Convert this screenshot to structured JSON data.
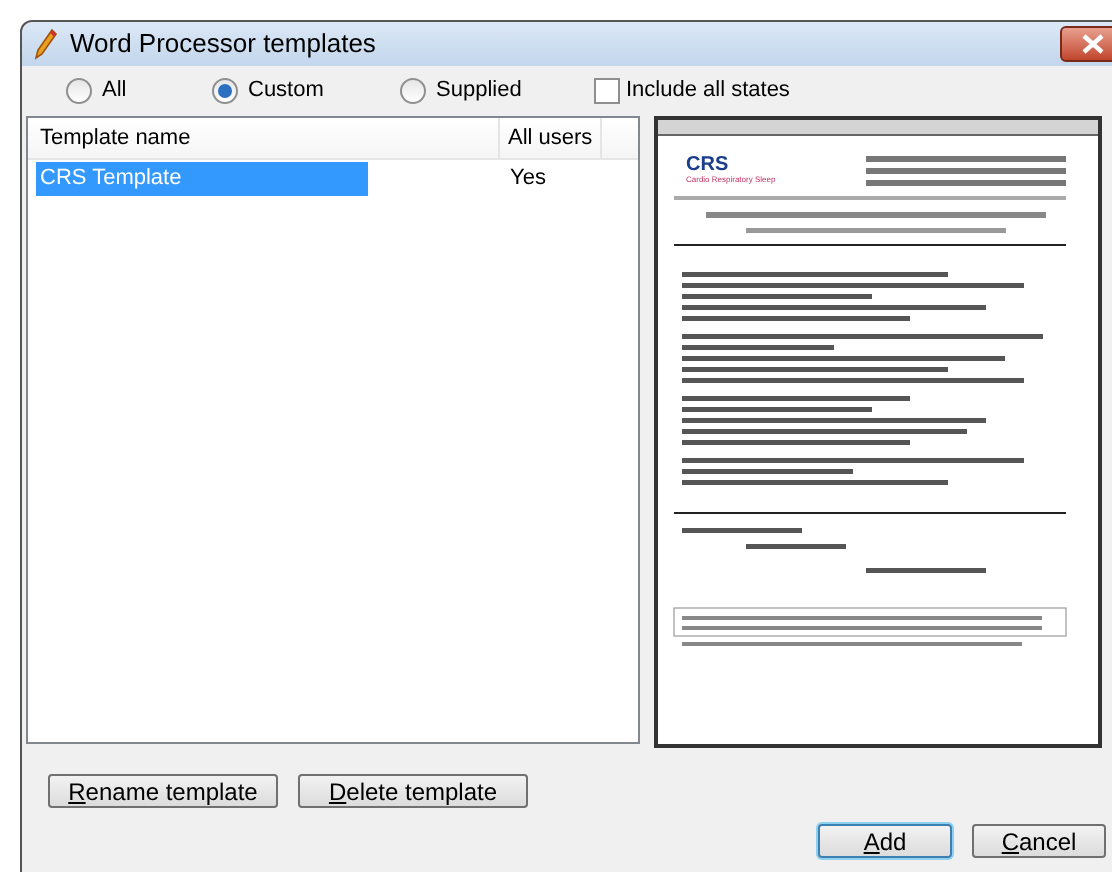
{
  "window": {
    "title": "Word Processor templates"
  },
  "filters": [
    {
      "label": "All",
      "selected": false
    },
    {
      "label": "Custom",
      "selected": true
    },
    {
      "label": "Supplied",
      "selected": false
    }
  ],
  "include_all_states": {
    "label": "Include all states",
    "checked": false
  },
  "table": {
    "columns": [
      "Template name",
      "All users"
    ],
    "rows": [
      {
        "cells": [
          "CRS Template",
          "Yes"
        ],
        "selected": true
      }
    ]
  },
  "preview": {
    "logo": "CRS",
    "subtitle": "Cardio Respiratory Sleep"
  },
  "actions": [
    "Rename template",
    "Delete template"
  ],
  "buttons": [
    {
      "label": "Add",
      "default": true
    },
    {
      "label": "Cancel",
      "default": false
    }
  ]
}
